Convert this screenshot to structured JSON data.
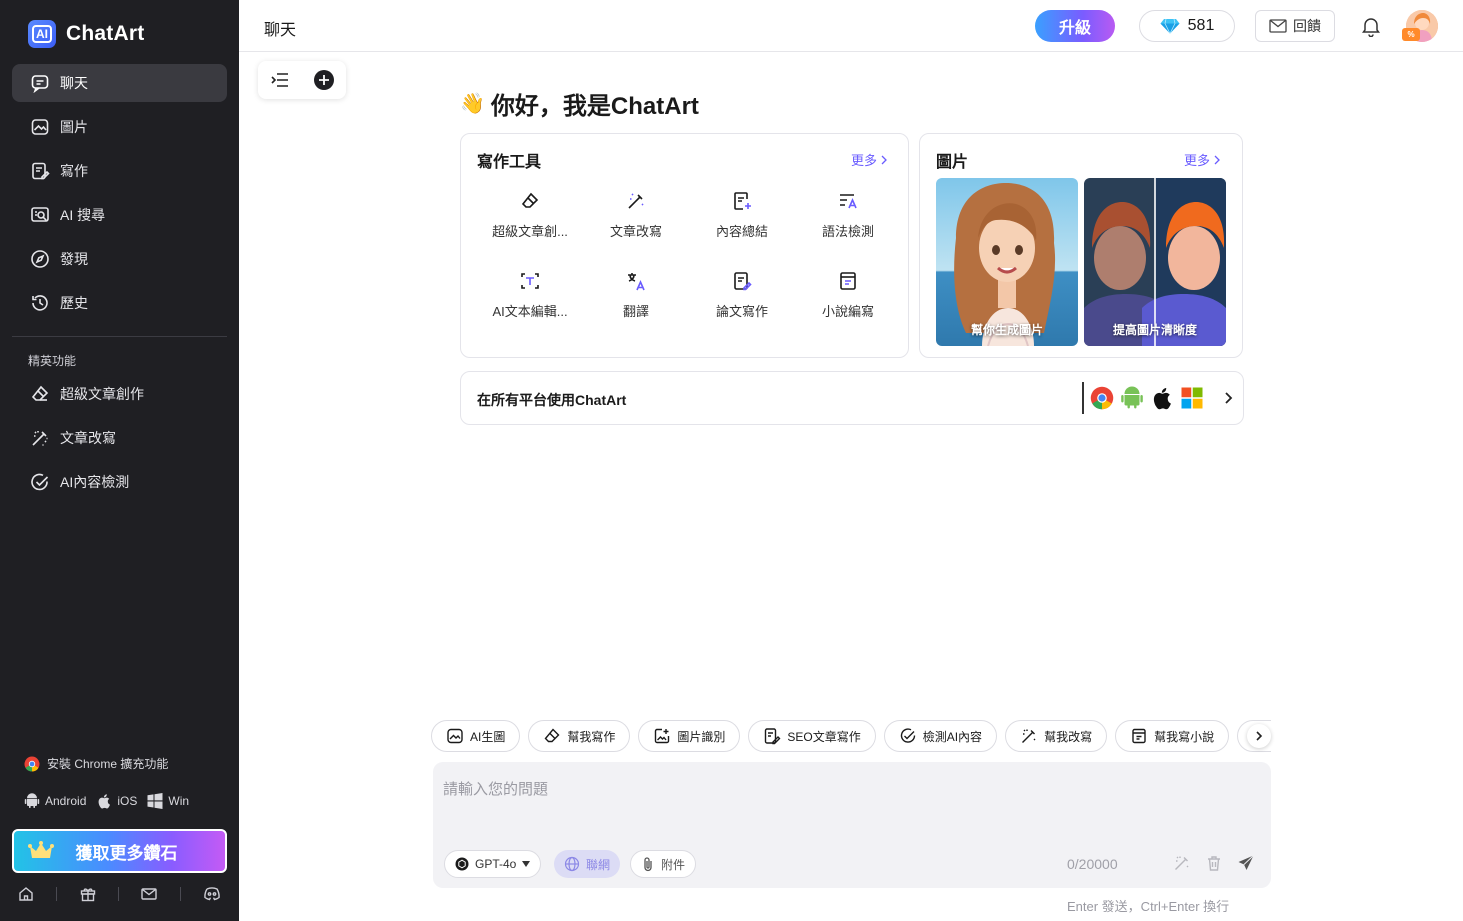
{
  "app": {
    "name": "ChatArt",
    "logo_mark": "AI"
  },
  "sidebar": {
    "nav": [
      {
        "label": "聊天",
        "icon": "chat-icon",
        "active": true
      },
      {
        "label": "圖片",
        "icon": "image-icon"
      },
      {
        "label": "寫作",
        "icon": "write-icon"
      },
      {
        "label": "AI 搜尋",
        "icon": "ai-search-icon"
      },
      {
        "label": "發現",
        "icon": "compass-icon"
      },
      {
        "label": "歷史",
        "icon": "history-icon"
      }
    ],
    "section_title": "精英功能",
    "elite": [
      {
        "label": "超級文章創作",
        "icon": "eraser-icon"
      },
      {
        "label": "文章改寫",
        "icon": "magic-wand-icon"
      },
      {
        "label": "AI內容檢測",
        "icon": "check-circle-icon"
      }
    ],
    "chrome_ext": "安裝 Chrome 擴充功能",
    "platforms": [
      "Android",
      "iOS",
      "Win"
    ],
    "cta": "獲取更多鑽石"
  },
  "topbar": {
    "title": "聊天",
    "upgrade": "升級",
    "gems": "581",
    "feedback": "回饋",
    "avatar_badge": "%"
  },
  "greeting": {
    "emoji": "👋",
    "text": "你好，我是ChatArt"
  },
  "writing_tools": {
    "title": "寫作工具",
    "more": "更多",
    "items": [
      {
        "label": "超級文章創...",
        "icon": "eraser-icon"
      },
      {
        "label": "文章改寫",
        "icon": "magic-wand-icon"
      },
      {
        "label": "內容總結",
        "icon": "summary-icon"
      },
      {
        "label": "語法檢測",
        "icon": "grammar-icon"
      },
      {
        "label": "AI文本編輯...",
        "icon": "text-edit-icon"
      },
      {
        "label": "翻譯",
        "icon": "translate-icon"
      },
      {
        "label": "論文寫作",
        "icon": "paper-icon"
      },
      {
        "label": "小說編寫",
        "icon": "novel-icon"
      }
    ]
  },
  "images": {
    "title": "圖片",
    "more": "更多",
    "tiles": [
      {
        "caption": "幫你生成圖片"
      },
      {
        "caption": "提高圖片清晰度"
      }
    ]
  },
  "platform_bar": {
    "text": "在所有平台使用ChatArt",
    "icons": [
      "chrome-icon",
      "android-icon",
      "apple-icon",
      "windows-icon"
    ]
  },
  "chips": [
    {
      "label": "AI生圖",
      "icon": "image-icon"
    },
    {
      "label": "幫我寫作",
      "icon": "eraser-icon"
    },
    {
      "label": "圖片識別",
      "icon": "image-recognize-icon"
    },
    {
      "label": "SEO文章寫作",
      "icon": "write-icon"
    },
    {
      "label": "檢測AI內容",
      "icon": "check-circle-icon"
    },
    {
      "label": "幫我改寫",
      "icon": "magic-wand-icon"
    },
    {
      "label": "幫我寫小說",
      "icon": "novel-icon"
    },
    {
      "label": "",
      "icon": "search-icon"
    }
  ],
  "composer": {
    "placeholder": "請輸入您的問題",
    "model": "GPT-4o",
    "web": "聯網",
    "attach": "附件",
    "counter": "0/20000",
    "hint": "Enter 發送，Ctrl+Enter 換行"
  },
  "colors": {
    "accent": "#6a5cff",
    "sidebar_bg": "#1f1f23"
  }
}
